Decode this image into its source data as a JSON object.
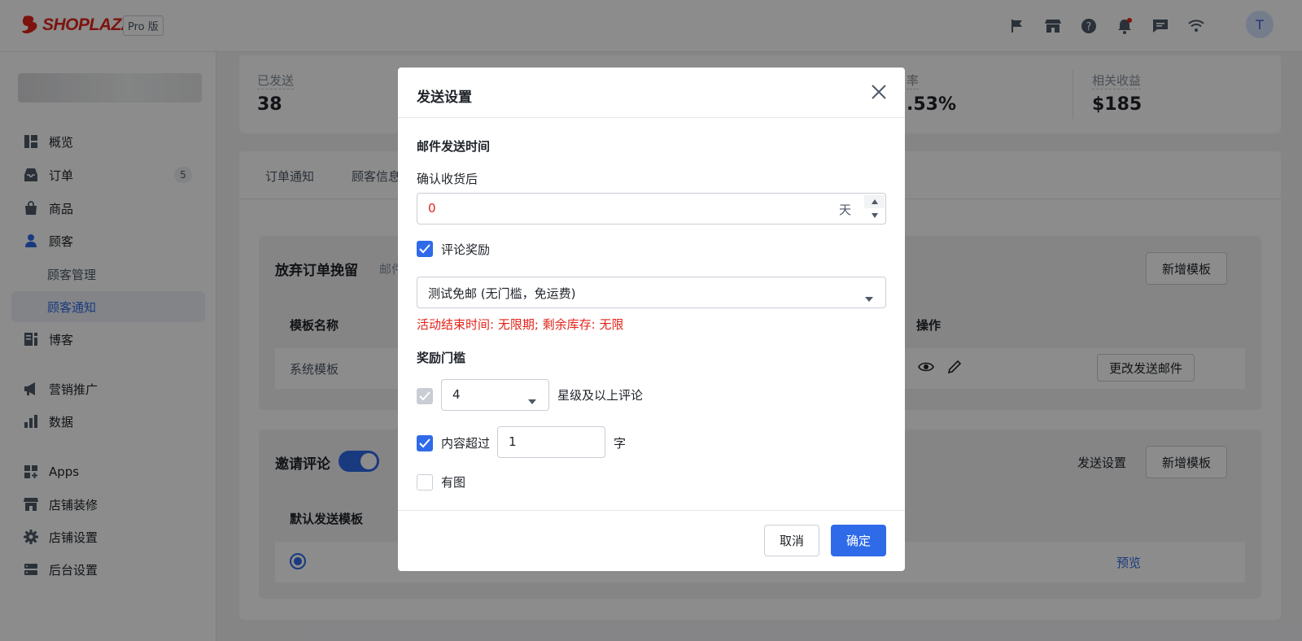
{
  "topbar": {
    "logo": "SHOPLAZZA",
    "plan": "Pro 版",
    "avatar": "T"
  },
  "sidebar": {
    "items": [
      {
        "label": "概览"
      },
      {
        "label": "订单",
        "badge": "5"
      },
      {
        "label": "商品"
      },
      {
        "label": "顾客"
      },
      {
        "label": "顾客管理"
      },
      {
        "label": "顾客通知"
      },
      {
        "label": "博客"
      },
      {
        "label": "营销推广"
      },
      {
        "label": "数据"
      },
      {
        "label": "Apps"
      },
      {
        "label": "店铺装修"
      },
      {
        "label": "店铺设置"
      },
      {
        "label": "后台设置"
      }
    ]
  },
  "stats": [
    {
      "label": "已发送",
      "value": "38"
    },
    {
      "label": "率",
      "value": ".53%"
    },
    {
      "label": "相关收益",
      "value": "$185"
    }
  ],
  "tabs": [
    "订单通知",
    "顾客信息"
  ],
  "abandon": {
    "title": "放弃订单挽留",
    "desc": "邮件",
    "add_button": "新增模板",
    "col_name": "模板名称",
    "col_action": "操作",
    "row_name": "系统模板",
    "row_button": "更改发送邮件"
  },
  "review": {
    "title": "邀请评论",
    "send_settings": "发送设置",
    "add_button": "新增模板",
    "col_default": "默认发送模板",
    "preview": "预览"
  },
  "modal": {
    "title": "发送设置",
    "section_time": "邮件发送时间",
    "after_label": "确认收货后",
    "days_value": "0",
    "days_unit": "天",
    "reward_label": "评论奖励",
    "coupon": "测试免邮 (无门槛，免运费)",
    "coupon_info": "活动结束时间: 无限期; 剩余库存: 无限",
    "threshold_title": "奖励门槛",
    "star_value": "4",
    "star_suffix": "星级及以上评论",
    "content_label": "内容超过",
    "content_value": "1",
    "content_unit": "字",
    "image_label": "有图",
    "cancel": "取消",
    "confirm": "确定"
  },
  "colors": {
    "accent": "#2f6be8",
    "brand": "#e2231a",
    "error": "#e2231a"
  }
}
